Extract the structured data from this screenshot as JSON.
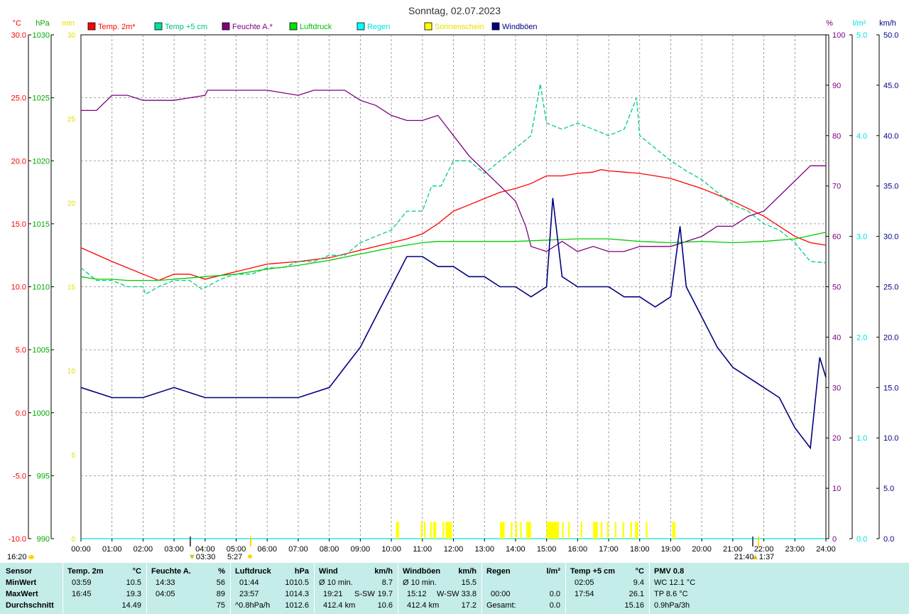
{
  "chart_data": {
    "type": "line",
    "title": "Sonntag, 02.07.2023",
    "x_ticks": [
      "00:00",
      "01:00",
      "02:00",
      "03:00",
      "04:00",
      "05:00",
      "06:00",
      "07:00",
      "08:00",
      "09:00",
      "10:00",
      "11:00",
      "12:00",
      "13:00",
      "14:00",
      "15:00",
      "16:00",
      "17:00",
      "18:00",
      "19:00",
      "20:00",
      "21:00",
      "22:00",
      "23:00",
      "24:00"
    ],
    "xlim": [
      0,
      24
    ],
    "grid": true,
    "legend_position": "top",
    "axes": {
      "temp": {
        "unit": "°C",
        "range": [
          -10,
          30
        ],
        "ticks": [
          "30.0",
          "25.0",
          "20.0",
          "15.0",
          "10.0",
          "5.0",
          "0.0",
          "-5.0",
          "-10.0"
        ],
        "color": "#ff0000"
      },
      "pressure": {
        "unit": "hPa",
        "range": [
          990,
          1030
        ],
        "ticks": [
          "1030",
          "1025",
          "1020",
          "1015",
          "1010",
          "1005",
          "1000",
          "995",
          "990"
        ],
        "color": "#00aa00"
      },
      "sun_minutes": {
        "unit": "min",
        "range": [
          0,
          30
        ],
        "ticks": [
          "30",
          "25",
          "20",
          "15",
          "10",
          "5",
          "0"
        ],
        "color": "#e0e000"
      },
      "humidity": {
        "unit": "%",
        "range": [
          0,
          100
        ],
        "ticks": [
          "100",
          "90",
          "80",
          "70",
          "60",
          "50",
          "40",
          "30",
          "20",
          "10",
          "0"
        ],
        "color": "#800080"
      },
      "rain": {
        "unit": "l/m²",
        "range": [
          0,
          5
        ],
        "ticks": [
          "5.0",
          "4.0",
          "3.0",
          "2.0",
          "1.0",
          "0.0"
        ],
        "color": "#00e0e0"
      },
      "wind": {
        "unit": "km/h",
        "range": [
          0,
          50
        ],
        "ticks": [
          "50.0",
          "45.0",
          "40.0",
          "35.0",
          "30.0",
          "25.0",
          "20.0",
          "15.0",
          "10.0",
          "5.0",
          "0.0"
        ],
        "color": "#000080"
      }
    },
    "series": [
      {
        "name": "Temp. 2m*",
        "color": "#ff0000",
        "axis": "temp",
        "x": [
          0,
          1,
          2,
          2.5,
          3,
          3.5,
          4,
          5,
          6,
          7,
          8,
          9,
          10,
          10.5,
          11,
          11.5,
          12,
          12.5,
          13,
          13.5,
          14,
          14.5,
          15,
          15.5,
          16,
          16.5,
          16.75,
          17,
          17.5,
          18,
          18.5,
          19,
          19.5,
          20,
          20.5,
          21,
          21.5,
          22,
          22.5,
          23,
          23.5,
          24
        ],
        "y": [
          13.1,
          12,
          11,
          10.5,
          11,
          11,
          10.6,
          11.2,
          11.8,
          12,
          12.3,
          12.9,
          13.5,
          13.8,
          14.2,
          15,
          16,
          16.5,
          17,
          17.5,
          17.8,
          18.2,
          18.8,
          18.8,
          19,
          19.1,
          19.3,
          19.2,
          19.1,
          19,
          18.8,
          18.6,
          18.2,
          17.8,
          17.3,
          16.8,
          16.2,
          15.6,
          14.8,
          14,
          13.5,
          13.3
        ]
      },
      {
        "name": "Temp +5 cm",
        "color": "#00cc88",
        "axis": "temp",
        "x": [
          0,
          0.5,
          1,
          1.5,
          2,
          2.08,
          2.5,
          3,
          3.5,
          3.9,
          4.5,
          5,
          5.5,
          6,
          6.5,
          7,
          7.5,
          8,
          8.5,
          9,
          9.5,
          10,
          10.5,
          11,
          11.3,
          11.6,
          12,
          12.5,
          13,
          13.5,
          14,
          14.5,
          14.8,
          15,
          15.5,
          16,
          16.5,
          17,
          17.5,
          17.9,
          18,
          18.5,
          19,
          19.5,
          20,
          20.5,
          21,
          21.5,
          22,
          22.5,
          23,
          23.5,
          24
        ],
        "y": [
          11.5,
          10.5,
          10.5,
          10,
          10,
          9.4,
          10,
          10.5,
          10.5,
          9.8,
          10.6,
          11,
          11,
          11.5,
          11.5,
          12,
          12,
          12.5,
          12.5,
          13.5,
          14,
          14.5,
          16,
          16,
          18,
          18,
          20,
          20,
          19,
          20,
          21,
          22,
          26.1,
          23,
          22.5,
          23,
          22.5,
          22,
          22.5,
          25,
          22,
          21,
          20,
          19.2,
          18.5,
          17.5,
          16.5,
          16,
          15,
          14.5,
          13.5,
          12,
          11.9
        ]
      },
      {
        "name": "Feuchte A.*",
        "color": "#800080",
        "axis": "humidity",
        "x": [
          0,
          0.5,
          1,
          1.5,
          2,
          3,
          4,
          4.08,
          5,
          6,
          7,
          7.5,
          8,
          8.5,
          9,
          9.5,
          10,
          10.5,
          11,
          11.5,
          12,
          12.5,
          13,
          13.5,
          14,
          14.33,
          14.5,
          15,
          15.5,
          16,
          16.5,
          17,
          17.5,
          18,
          18.5,
          19,
          19.5,
          20,
          20.5,
          21,
          21.5,
          22,
          22.5,
          23,
          23.5,
          24
        ],
        "y": [
          85,
          85,
          88,
          88,
          87,
          87,
          88,
          89,
          89,
          89,
          88,
          89,
          89,
          89,
          87,
          86,
          84,
          83,
          83,
          84,
          80,
          76,
          73,
          70,
          67,
          62,
          58,
          57,
          59,
          57,
          58,
          57,
          57,
          58,
          58,
          58,
          59,
          60,
          62,
          62,
          64,
          65,
          68,
          71,
          74,
          74
        ]
      },
      {
        "name": "Luftdruck",
        "color": "#00cc00",
        "axis": "pressure",
        "x": [
          0,
          0.5,
          1,
          1.5,
          2,
          2.5,
          3,
          4,
          5,
          6,
          7,
          8,
          9,
          10,
          10.5,
          11,
          11.5,
          12,
          12.5,
          13,
          14,
          15,
          16,
          17,
          18,
          19,
          20,
          21,
          22,
          23,
          23.95,
          24
        ],
        "y": [
          1010.8,
          1010.6,
          1010.6,
          1010.5,
          1010.5,
          1010.5,
          1010.6,
          1010.8,
          1011,
          1011.4,
          1011.7,
          1012.1,
          1012.6,
          1013.1,
          1013.3,
          1013.5,
          1013.6,
          1013.6,
          1013.6,
          1013.6,
          1013.6,
          1013.7,
          1013.8,
          1013.8,
          1013.6,
          1013.5,
          1013.6,
          1013.5,
          1013.6,
          1013.8,
          1014.3,
          1014.3
        ]
      },
      {
        "name": "Regen",
        "color": "#00e0e0",
        "axis": "rain",
        "x": [
          0,
          24
        ],
        "y": [
          0,
          0
        ]
      },
      {
        "name": "Sonnenschein",
        "color": "#ffff00",
        "axis": "sun_minutes",
        "bars": [
          [
            10.15,
            10.25
          ],
          [
            10.95,
            11.0
          ],
          [
            11.05,
            11.1
          ],
          [
            11.25,
            11.3
          ],
          [
            11.35,
            11.45
          ],
          [
            11.65,
            11.7
          ],
          [
            11.75,
            11.95
          ],
          [
            13.5,
            13.65
          ],
          [
            13.85,
            13.9
          ],
          [
            14.0,
            14.05
          ],
          [
            14.15,
            14.2
          ],
          [
            14.35,
            14.5
          ],
          [
            15.0,
            15.4
          ],
          [
            15.5,
            15.55
          ],
          [
            15.7,
            15.75
          ],
          [
            16.1,
            16.15
          ],
          [
            16.5,
            16.65
          ],
          [
            16.75,
            16.8
          ],
          [
            16.95,
            17.0
          ],
          [
            17.2,
            17.25
          ],
          [
            17.45,
            17.5
          ],
          [
            17.7,
            17.75
          ],
          [
            17.85,
            17.95
          ],
          [
            18.2,
            18.25
          ],
          [
            19.05,
            19.15
          ]
        ],
        "height": 1.0
      },
      {
        "name": "Windböen",
        "color": "#000080",
        "axis": "wind",
        "x": [
          0,
          1,
          2,
          3,
          4,
          5,
          6,
          7,
          8,
          8.5,
          9,
          9.5,
          10,
          10.5,
          11,
          11.5,
          12,
          12.5,
          13,
          13.5,
          14,
          14.5,
          15,
          15.2,
          15.5,
          16,
          16.5,
          17,
          17.5,
          18,
          18.5,
          19,
          19.3,
          19.5,
          20,
          20.5,
          21,
          21.5,
          22,
          22.5,
          23,
          23.5,
          23.8,
          24
        ],
        "y": [
          15,
          14,
          14,
          15,
          14,
          14,
          14,
          14,
          15,
          17,
          19,
          22,
          25,
          28,
          28,
          27,
          27,
          26,
          26,
          25,
          25,
          24,
          25,
          33.8,
          26,
          25,
          25,
          25,
          24,
          24,
          23,
          24,
          31,
          25,
          22,
          19,
          17,
          16,
          15,
          14,
          11,
          9,
          18,
          16
        ]
      }
    ]
  },
  "legend": [
    {
      "label": "Temp. 2m*",
      "color": "#ff0000",
      "text_color": "#ff0000"
    },
    {
      "label": "Temp +5 cm",
      "color": "#00e0a0",
      "text_color": "#00c080"
    },
    {
      "label": "Feuchte A.*",
      "color": "#800080",
      "text_color": "#800080"
    },
    {
      "label": "Luftdruck",
      "color": "#00e000",
      "text_color": "#00c000"
    },
    {
      "label": "Regen",
      "color": "#00ffff",
      "text_color": "#00e0e0"
    },
    {
      "label": "Sonnenschein",
      "color": "#ffff00",
      "text_color": "#e8e000"
    },
    {
      "label": "Windböen",
      "color": "#000080",
      "text_color": "#000080"
    }
  ],
  "markers": {
    "sunrise": "5:27",
    "sunset": "21:40",
    "moonset": "03:30",
    "moonrise": "1:37",
    "left_corner": "16:20"
  },
  "stats": {
    "sensor": {
      "header": "Sensor",
      "rows": [
        "MinWert",
        "MaxWert",
        "Durchschnitt"
      ]
    },
    "temp2m": {
      "header": "Temp. 2m",
      "unit": "°C",
      "min_time": "03:59",
      "min": "10.5",
      "max_time": "16:45",
      "max": "19.3",
      "avg": "14.49"
    },
    "humidity": {
      "header": "Feuchte A.",
      "unit": "%",
      "min_time": "14:33",
      "min": "56",
      "max_time": "04:05",
      "max": "89",
      "avg": "75"
    },
    "pressure": {
      "header": "Luftdruck",
      "unit": "hPa",
      "min_time": "01:44",
      "min": "1010.5",
      "max_time": "23:57",
      "max": "1014.3",
      "trend": "^0.8hPa/h",
      "avg": "1012.6"
    },
    "wind": {
      "header": "Wind",
      "unit": "km/h",
      "r1_label": "Ø 10 min.",
      "r1": "8.7",
      "r2_time": "19:21",
      "r2_dir": "S-SW",
      "r2": "19.7",
      "r3_dist": "412.4 km",
      "r3": "10.6"
    },
    "gust": {
      "header": "Windböen",
      "unit": "km/h",
      "r1_label": "Ø 10 min.",
      "r1": "15.5",
      "r2_time": "15:12",
      "r2_dir": "W-SW",
      "r2": "33.8",
      "r3_dist": "412.4 km",
      "r3": "17.2"
    },
    "rain": {
      "header": "Regen",
      "unit": "l/m²",
      "r2_time": "00:00",
      "r2": "0.0",
      "r3_label": "Gesamt:",
      "r3": "0.0"
    },
    "temp5": {
      "header": "Temp +5 cm",
      "unit": "°C",
      "min_time": "02:05",
      "min": "9.4",
      "max_time": "17:54",
      "max": "26.1",
      "avg": "15.16"
    },
    "pmv": {
      "header": "PMV 0.8",
      "r1": "WC 12.1 °C",
      "r2": "TP 8.6 °C",
      "r3": "0.9hPa/3h"
    }
  }
}
